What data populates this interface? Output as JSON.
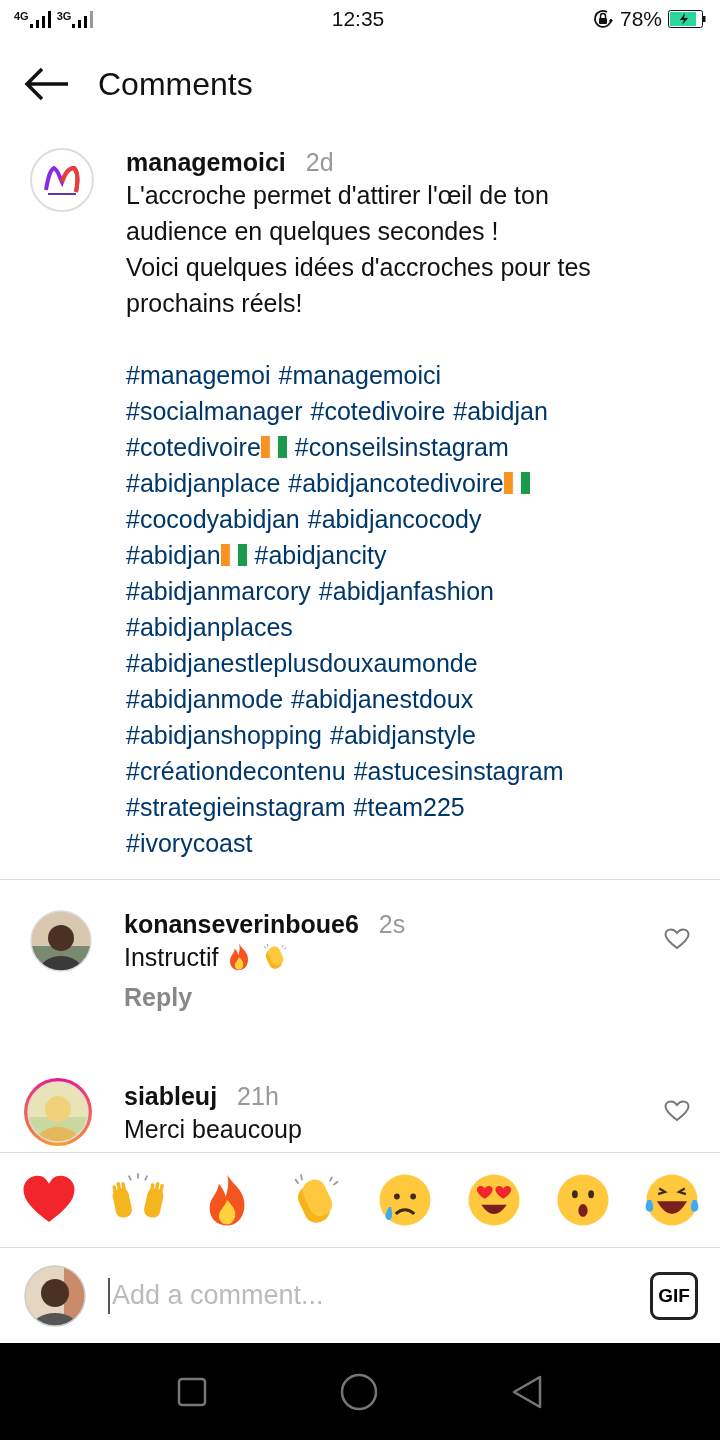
{
  "status_bar": {
    "network_1": "4G",
    "network_2": "3G",
    "time": "12:35",
    "battery": "78%"
  },
  "header": {
    "title": "Comments"
  },
  "post": {
    "username": "managemoici",
    "age": "2d",
    "paragraphs": [
      "L'accroche permet d'attirer l'œil de ton audience en quelques secondes !",
      "Voici quelques idées d'accroches pour tes prochains réels!"
    ],
    "hashtag_lines": [
      [
        {
          "text": "#managemoi",
          "flag": false
        },
        {
          "text": "#managemoici",
          "flag": false
        }
      ],
      [
        {
          "text": "#socialmanager",
          "flag": false
        },
        {
          "text": "#cotedivoire",
          "flag": false
        },
        {
          "text": "#abidjan",
          "flag": false
        }
      ],
      [
        {
          "text": "#cotedivoire",
          "flag": true
        },
        {
          "text": "#conseilsinstagram",
          "flag": false
        }
      ],
      [
        {
          "text": "#abidjanplace",
          "flag": false
        },
        {
          "text": "#abidjancotedivoire",
          "flag": true
        }
      ],
      [
        {
          "text": "#cocodyabidjan",
          "flag": false
        },
        {
          "text": "#abidjancocody",
          "flag": false
        }
      ],
      [
        {
          "text": "#abidjan",
          "flag": true
        },
        {
          "text": "#abidjancity",
          "flag": false
        }
      ],
      [
        {
          "text": "#abidjanmarcory",
          "flag": false
        },
        {
          "text": "#abidjanfashion",
          "flag": false
        }
      ],
      [
        {
          "text": "#abidjanplaces",
          "flag": false
        }
      ],
      [
        {
          "text": "#abidjanestleplusdouxaumonde",
          "flag": false
        }
      ],
      [
        {
          "text": "#abidjanmode",
          "flag": false
        },
        {
          "text": "#abidjanestdoux",
          "flag": false
        }
      ],
      [
        {
          "text": "#abidjanshopping",
          "flag": false
        },
        {
          "text": "#abidjanstyle",
          "flag": false
        }
      ],
      [
        {
          "text": "#créationdecontenu",
          "flag": false
        },
        {
          "text": "#astucesinstagram",
          "flag": false
        }
      ],
      [
        {
          "text": "#strategieinstagram",
          "flag": false
        },
        {
          "text": "#team225",
          "flag": false
        }
      ],
      [
        {
          "text": "#ivorycoast",
          "flag": false
        }
      ]
    ]
  },
  "comments": [
    {
      "username": "konanseverinboue6",
      "age": "2s",
      "text": "Instructif",
      "emojis": [
        {
          "kind": "fire"
        },
        {
          "kind": "clap"
        }
      ],
      "reply": "Reply",
      "story_ring": false
    },
    {
      "username": "siableuj",
      "age": "21h",
      "text": "Merci beaucoup",
      "story_ring": true
    }
  ],
  "reactions": [
    {
      "kind": "heart"
    },
    {
      "kind": "raised-hands"
    },
    {
      "kind": "fire"
    },
    {
      "kind": "clap"
    },
    {
      "kind": "sad"
    },
    {
      "kind": "heart-eyes"
    },
    {
      "kind": "surprised"
    },
    {
      "kind": "laugh"
    }
  ],
  "composer": {
    "placeholder": "Add a comment...",
    "gif": "GIF"
  }
}
